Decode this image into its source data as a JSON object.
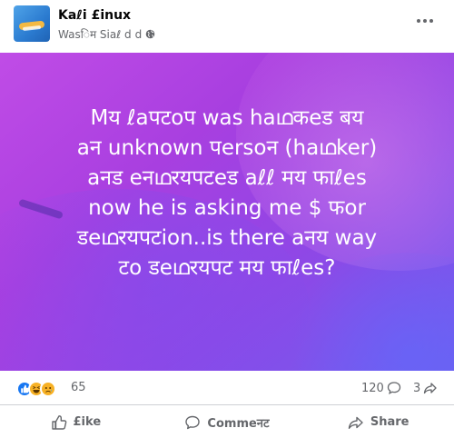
{
  "header": {
    "page_name": "Kaℓi £inux",
    "meta_text": "Wasिम Siaℓ d",
    "meta_suffix": "d"
  },
  "post": {
    "lines": [
      "Mय ℓaपटoप was haഥकeड बय",
      "aन unknown पersoन (haഥker)",
      "aनड eनഥरयपटeड aℓℓ मय फाℓes",
      "now he is asking me $ फor",
      "डeഥरयपटion..is there aनय way",
      "टo डeഥरयपट मय फाℓes?"
    ],
    "colors": {
      "gradient_start": "#c04ce6",
      "gradient_end": "#6f5ef0",
      "text": "#ffffff"
    }
  },
  "stats": {
    "reaction_count": "65",
    "comment_count": "120",
    "share_count": "3"
  },
  "actions": {
    "like_label": "£ike",
    "comment_label": "Commeनट",
    "share_label": "Share"
  },
  "colors": {
    "secondary_text": "#65676b",
    "like_blue": "#1877f2"
  },
  "icons": {
    "privacy": "globe-icon",
    "more": "more-icon",
    "like": "thumbs-up-icon",
    "comment": "speech-bubble-icon",
    "share": "share-arrow-icon"
  }
}
